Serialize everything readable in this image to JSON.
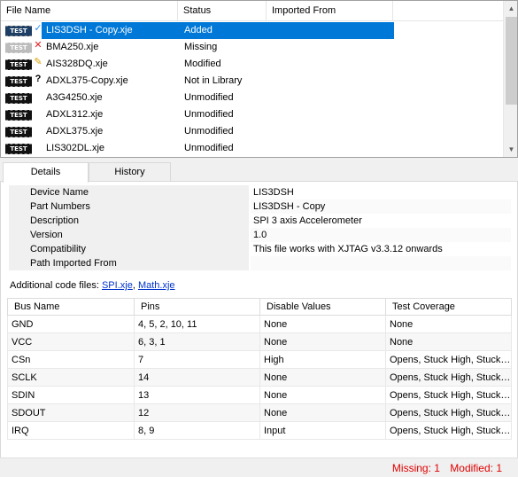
{
  "file_list": {
    "columns": [
      "File Name",
      "Status",
      "Imported From"
    ],
    "rows": [
      {
        "name": "LIS3DSH - Copy.xje",
        "status": "Added",
        "icon": "test-chip-check-icon",
        "badge": "✓",
        "selected": true
      },
      {
        "name": "BMA250.xje",
        "status": "Missing",
        "icon": "test-chip-missing-icon",
        "badge": "✕"
      },
      {
        "name": "AIS328DQ.xje",
        "status": "Modified",
        "icon": "test-chip-pencil-icon",
        "badge": "✎"
      },
      {
        "name": "ADXL375-Copy.xje",
        "status": "Not in Library",
        "icon": "test-chip-question-icon",
        "badge": "?"
      },
      {
        "name": "A3G4250.xje",
        "status": "Unmodified",
        "icon": "test-chip-icon",
        "badge": ""
      },
      {
        "name": "ADXL312.xje",
        "status": "Unmodified",
        "icon": "test-chip-icon",
        "badge": ""
      },
      {
        "name": "ADXL375.xje",
        "status": "Unmodified",
        "icon": "test-chip-icon",
        "badge": ""
      },
      {
        "name": "LIS302DL.xje",
        "status": "Unmodified",
        "icon": "test-chip-icon",
        "badge": ""
      }
    ],
    "chip_label": "TEST"
  },
  "tabs": [
    "Details",
    "History"
  ],
  "properties": [
    {
      "key": "Device Name",
      "value": "LIS3DSH"
    },
    {
      "key": "Part Numbers",
      "value": "LIS3DSH - Copy"
    },
    {
      "key": "Description",
      "value": "SPI 3 axis Accelerometer"
    },
    {
      "key": "Version",
      "value": "1.0"
    },
    {
      "key": "Compatibility",
      "value": "This file works with XJTAG v3.3.12 onwards"
    },
    {
      "key": "Path Imported From",
      "value": ""
    }
  ],
  "additional_code": {
    "label": "Additional code files:",
    "files": [
      "SPI.xje",
      "Math.xje"
    ]
  },
  "bus_table": {
    "columns": [
      "Bus Name",
      "Pins",
      "Disable Values",
      "Test Coverage"
    ],
    "rows": [
      [
        "GND",
        "4, 5, 2, 10, 11",
        "None",
        "None"
      ],
      [
        "VCC",
        "6, 3, 1",
        "None",
        "None"
      ],
      [
        "CSn",
        "7",
        "High",
        "Opens, Stuck High, Stuck…"
      ],
      [
        "SCLK",
        "14",
        "None",
        "Opens, Stuck High, Stuck…"
      ],
      [
        "SDIN",
        "13",
        "None",
        "Opens, Stuck High, Stuck…"
      ],
      [
        "SDOUT",
        "12",
        "None",
        "Opens, Stuck High, Stuck…"
      ],
      [
        "IRQ",
        "8, 9",
        "Input",
        "Opens, Stuck High, Stuck…"
      ]
    ]
  },
  "status_bar": {
    "missing": "Missing: 1",
    "modified": "Modified: 1"
  },
  "colors": {
    "selection": "#0078d7",
    "status_error": "#e00000",
    "link": "#0033cc"
  }
}
